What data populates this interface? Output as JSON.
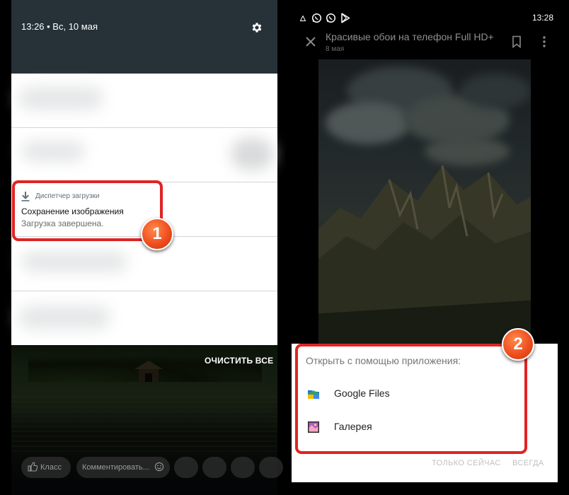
{
  "left_screen": {
    "status": {
      "time_date": "13:26 • Вс, 10 мая"
    },
    "notification": {
      "app_name": "Диспетчер загрузки",
      "title": "Сохранение изображения",
      "subtitle": "Загрузка завершена."
    },
    "clear_all_label": "ОЧИСТИТЬ ВСЕ",
    "bottom_bar": {
      "like_label": "Класс",
      "comment_placeholder": "Комментировать..."
    },
    "callout_number": "1"
  },
  "right_screen": {
    "status": {
      "time": "13:28",
      "icons": [
        "warning-icon",
        "whatsapp-icon",
        "whatsapp-icon",
        "play-store-icon"
      ]
    },
    "header": {
      "title": "Красивые обои на телефон Full HD+",
      "date": "8 мая"
    },
    "dialog": {
      "title": "Открыть с помощью приложения:",
      "apps": [
        {
          "label": "Google Files",
          "icon": "google-files-icon"
        },
        {
          "label": "Галерея",
          "icon": "gallery-icon"
        }
      ],
      "just_once_label": "ТОЛЬКО СЕЙЧАС",
      "always_label": "ВСЕГДА"
    },
    "callout_number": "2"
  },
  "colors": {
    "callout_red": "#e02424",
    "badge_orange": "#ef4f1f",
    "status_bar_left": "#263238"
  }
}
